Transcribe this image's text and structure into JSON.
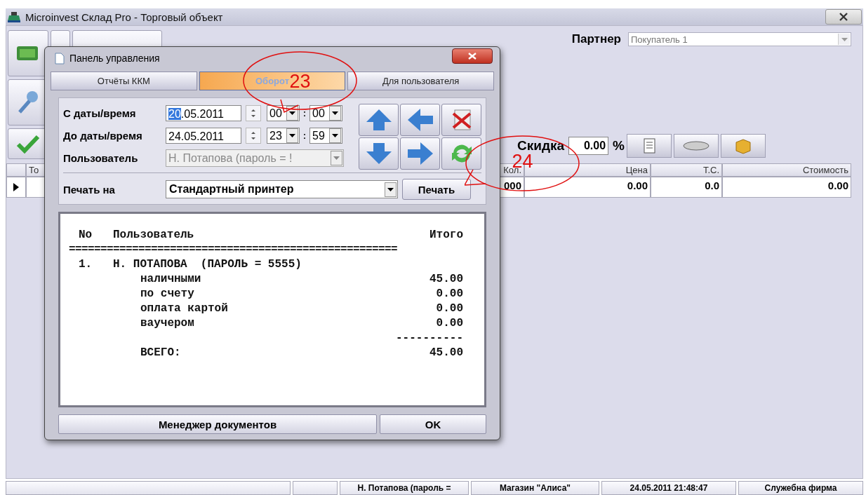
{
  "window": {
    "title": "Microinvest Склад Pro - Торговый объект"
  },
  "partner": {
    "label": "Партнер",
    "value": "Покупатель 1"
  },
  "discount": {
    "label": "Скидка",
    "value": "0.00",
    "unit": "%"
  },
  "table": {
    "columns": [
      "То",
      "Кол.",
      "Цена",
      "Т.С.",
      "Стоимость"
    ],
    "rows": [
      {
        "selected": true,
        "cells": [
          "",
          "000",
          "0.00",
          "0.0",
          "0.00"
        ]
      }
    ]
  },
  "status_bar": [
    "Н. Потапова  (пароль =",
    "Магазин \"Алиса\"",
    "24.05.2011 21:48:47",
    "Служебна фирма"
  ],
  "dialog": {
    "title": "Панель управления",
    "tabs": [
      {
        "label": "Отчёты ККМ",
        "selected": false
      },
      {
        "label": "Оборот",
        "selected": true
      },
      {
        "label": "Для пользователя",
        "selected": false
      }
    ],
    "from": {
      "label": "С даты/время",
      "date_parts": [
        {
          "text": "20",
          "selected": true
        },
        {
          "text": ".05.2011",
          "selected": false
        }
      ],
      "hour": "00",
      "separator": ":",
      "minute": "00"
    },
    "to": {
      "label": "До даты/время",
      "date_parts": [
        {
          "text": "24.05.2011",
          "selected": false
        }
      ],
      "hour": "23",
      "separator": ":",
      "minute": "59"
    },
    "user": {
      "label": "Пользователь",
      "value": "Н. Потапова  (пароль = !",
      "disabled": true
    },
    "print": {
      "label": "Печать на",
      "printer": "Стандартный принтер",
      "button": "Печать"
    },
    "report": [
      {
        "kind": "columns",
        "no": "No",
        "name": "Пользователь",
        "amount": "Итого"
      },
      {
        "kind": "rule",
        "text": "===================================================="
      },
      {
        "kind": "entry",
        "no": "1.",
        "name": "Н. ПОТАПОВА  (ПАРОЛЬ = 5555)"
      },
      {
        "kind": "item",
        "name": "наличными",
        "amount": "45.00"
      },
      {
        "kind": "item",
        "name": "по счету",
        "amount": "0.00"
      },
      {
        "kind": "item",
        "name": "оплата картой",
        "amount": "0.00"
      },
      {
        "kind": "item",
        "name": "ваучером",
        "amount": "0.00"
      },
      {
        "kind": "dash",
        "text": "----------"
      },
      {
        "kind": "item",
        "name": "ВСЕГО:",
        "amount": "45.00"
      }
    ],
    "buttons": [
      "Менеджер документов",
      "OK"
    ]
  },
  "annotations": [
    {
      "text": "23"
    },
    {
      "text": "24"
    }
  ]
}
